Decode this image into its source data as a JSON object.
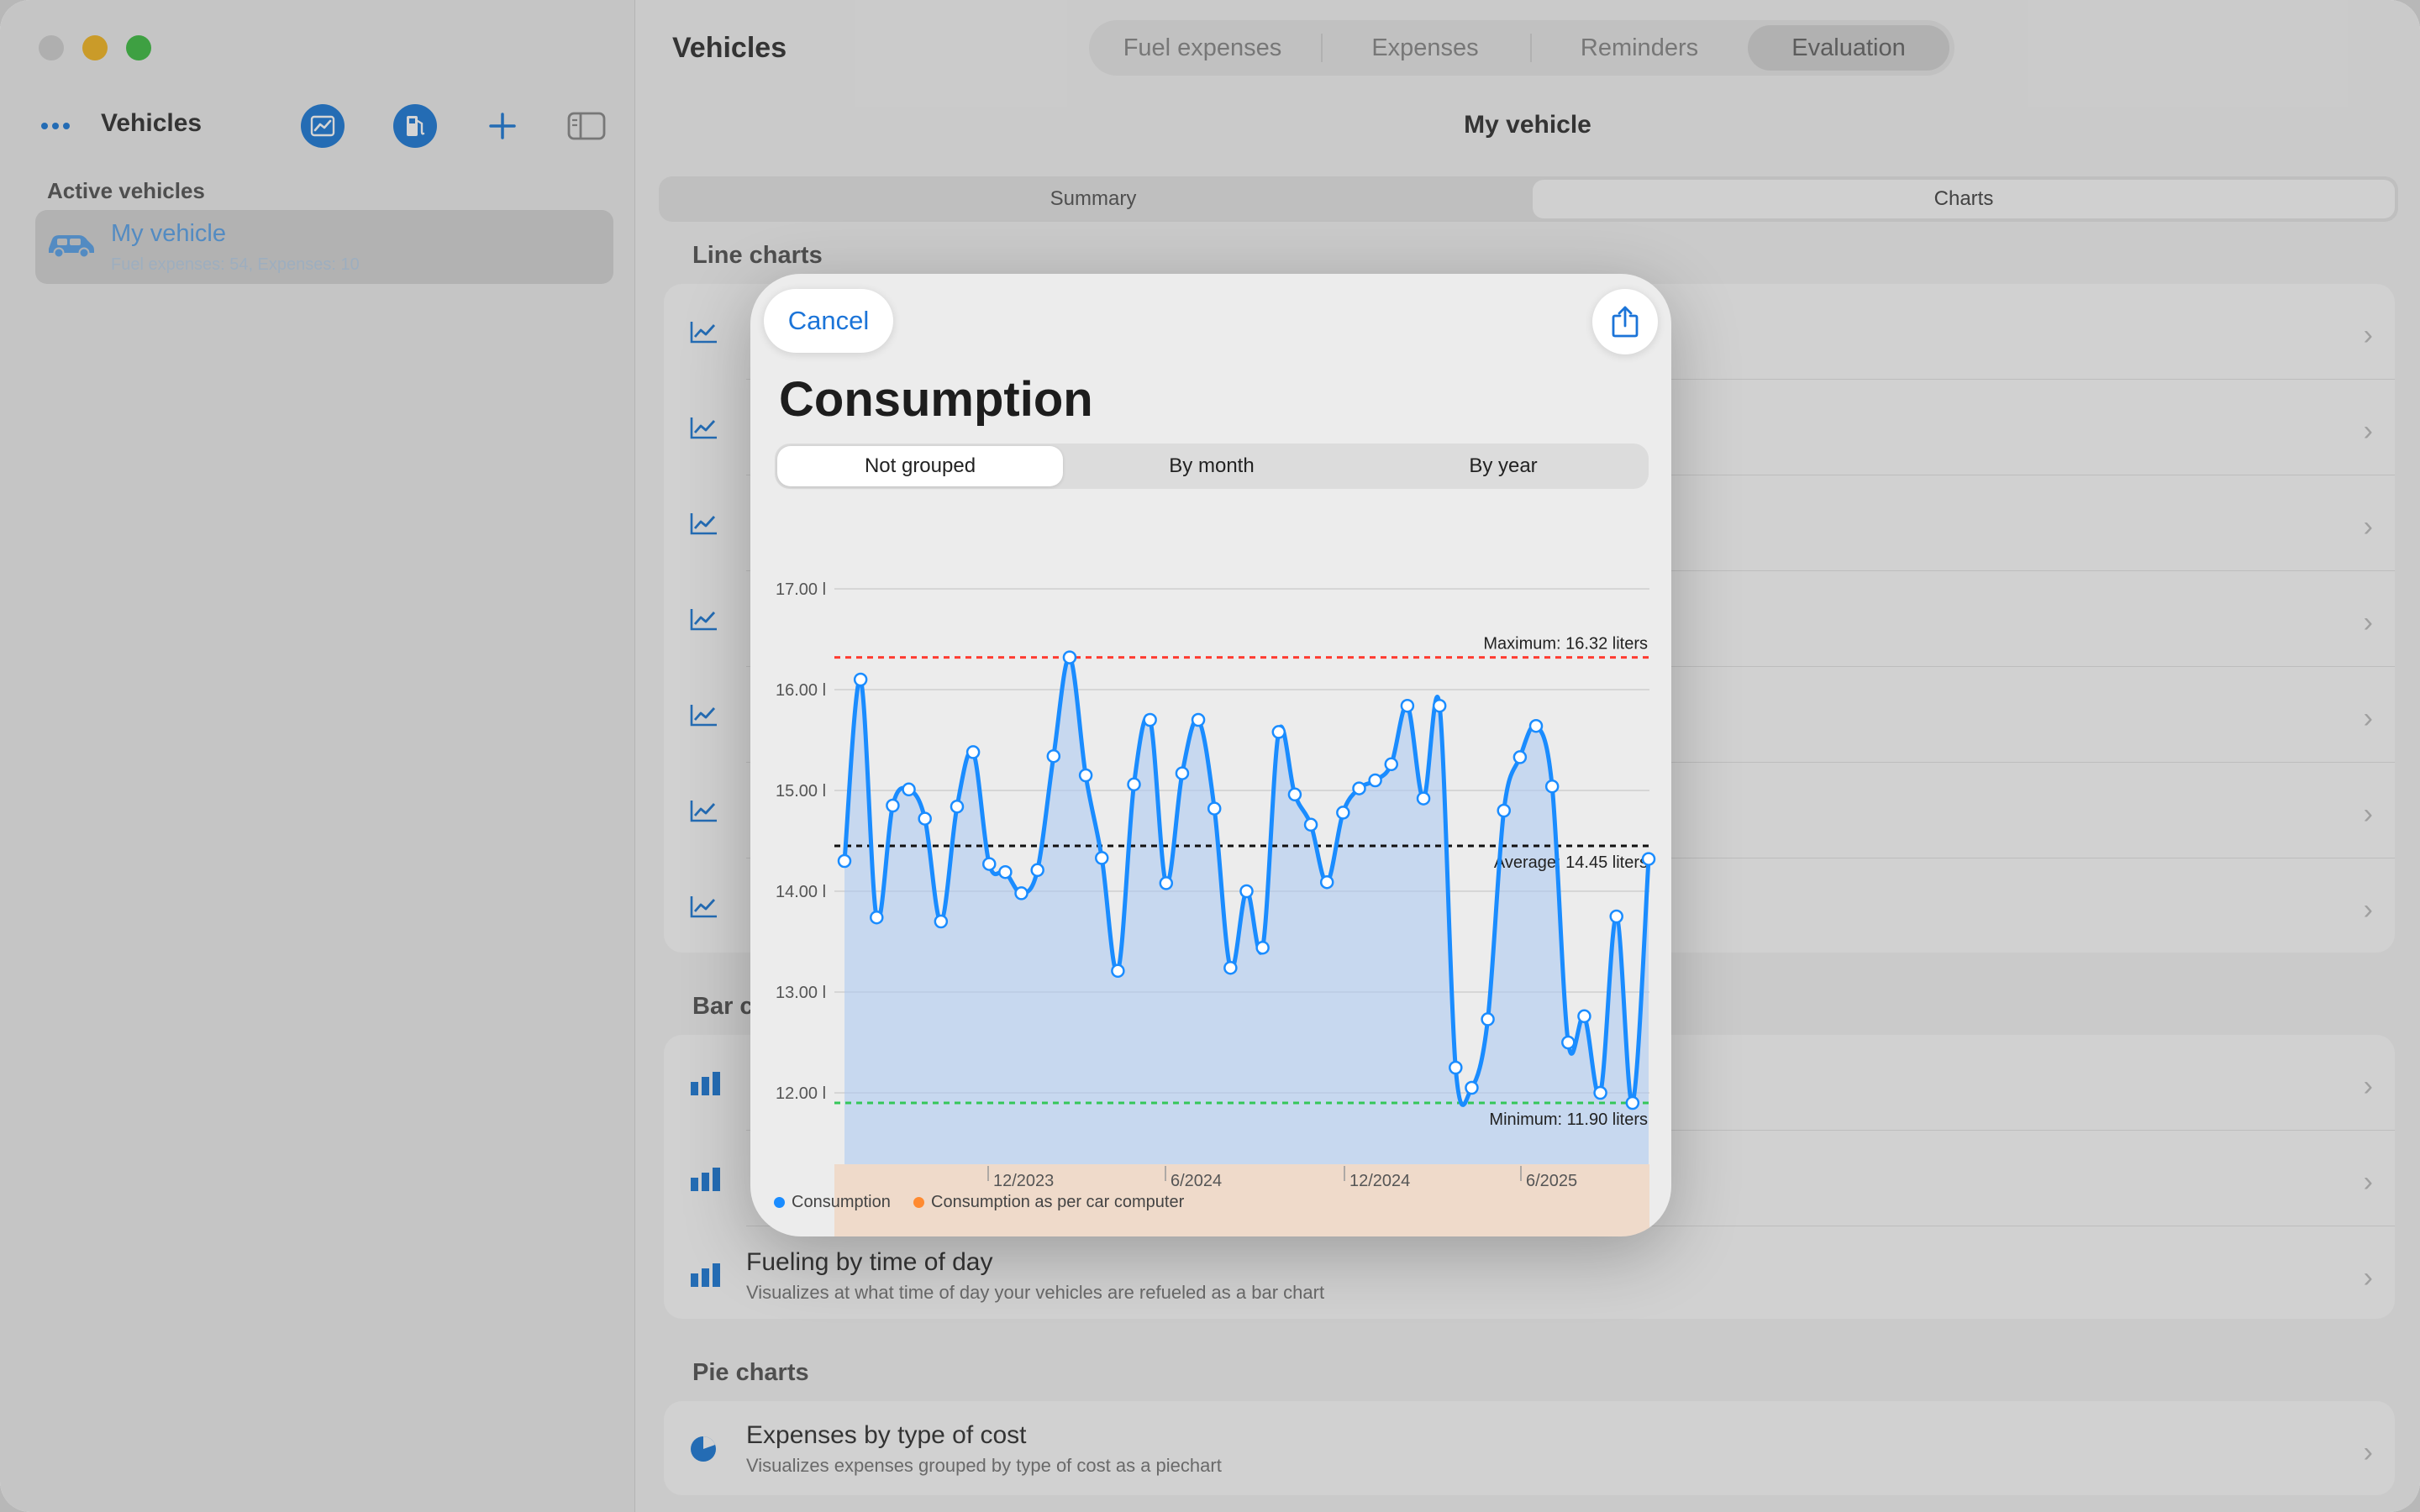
{
  "sidebar": {
    "title": "Vehicles",
    "section": "Active vehicles",
    "vehicle": {
      "name": "My vehicle",
      "subtitle": "Fuel expenses: 54, Expenses: 10"
    }
  },
  "main": {
    "title": "Vehicles",
    "tabs": [
      "Fuel expenses",
      "Expenses",
      "Reminders",
      "Evaluation"
    ],
    "selected_tab": "Evaluation",
    "vehicle_title": "My vehicle",
    "segments": [
      "Summary",
      "Charts"
    ],
    "line_section": "Line charts",
    "bar_section": "Bar c",
    "bar_row_3": {
      "title": "Fueling by time of day",
      "subtitle": "Visualizes at what time of day your vehicles are refueled as a bar chart"
    },
    "pie_section": "Pie charts",
    "pie_row": {
      "title": "Expenses by type of cost",
      "subtitle": "Visualizes expenses grouped by type of cost as a piechart"
    }
  },
  "modal": {
    "cancel": "Cancel",
    "title": "Consumption",
    "grouping": [
      "Not grouped",
      "By month",
      "By year"
    ],
    "selected_grouping": "Not grouped",
    "legend": [
      "Consumption",
      "Consumption as per car computer"
    ]
  },
  "colors": {
    "accent": "#1e7ad6",
    "consumption": "#1a8cff",
    "computer": "#ff8a30",
    "maximum": "#ff3b30",
    "average": "#111111",
    "minimum": "#34c759"
  },
  "chart_data": {
    "type": "line",
    "y_ticks": [
      12,
      13,
      14,
      15,
      16,
      17
    ],
    "y_tick_labels": [
      "12.00 l",
      "13.00 l",
      "14.00 l",
      "15.00 l",
      "16.00 l",
      "17.00 l"
    ],
    "ylim": [
      11.65,
      17.4
    ],
    "x_ticks": [
      "12/2023",
      "6/2024",
      "12/2024",
      "6/2025"
    ],
    "series": [
      {
        "name": "Consumption",
        "values": [
          14.3,
          16.1,
          13.74,
          14.85,
          15.01,
          14.72,
          13.7,
          14.84,
          15.38,
          14.27,
          14.19,
          13.98,
          14.21,
          15.34,
          16.32,
          15.15,
          14.33,
          13.21,
          15.06,
          15.7,
          14.08,
          15.17,
          15.7,
          14.82,
          13.24,
          14.0,
          13.44,
          15.58,
          14.96,
          14.66,
          14.09,
          14.78,
          15.02,
          15.1,
          15.26,
          15.84,
          14.92,
          15.84,
          12.25,
          12.05,
          12.73,
          14.8,
          15.33,
          15.64,
          15.04,
          12.5,
          12.76,
          12.0,
          13.75,
          11.9,
          14.32
        ]
      }
    ],
    "maximum": {
      "value": 16.32,
      "label": "Maximum: 16.32 liters"
    },
    "average": {
      "value": 14.45,
      "label": "Average: 14.45 liters"
    },
    "minimum": {
      "value": 11.9,
      "label": "Minimum: 11.90 liters"
    },
    "grid": true
  }
}
